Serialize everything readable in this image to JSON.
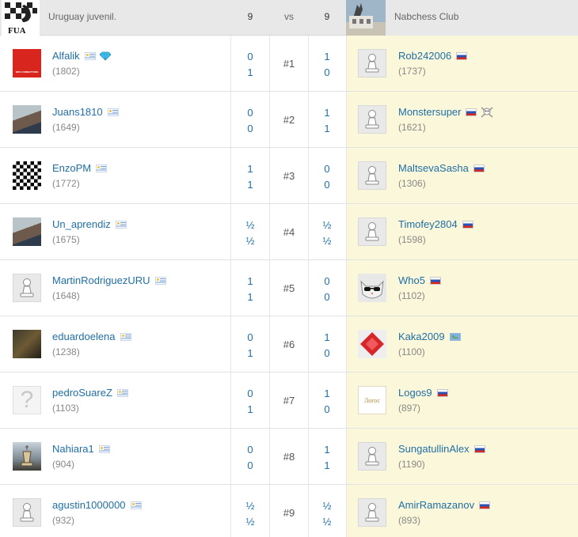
{
  "header": {
    "left_team": "Uruguay juvenil.",
    "left_score": "9",
    "vs": "vs",
    "right_score": "9",
    "right_team": "Nabchess Club",
    "left_logo_text": "FUA"
  },
  "colors": {
    "link": "#1f6fa5",
    "right_column_bg": "#fbf7db",
    "header_bg": "#e8e8e8"
  },
  "rows": [
    {
      "board": "#1",
      "left": {
        "name": "Alfalik",
        "rating": "(1802)",
        "flag": "uy",
        "badge": "diamond-icon",
        "avatar": "red-photo",
        "avatar_text": "NOS COMBATTONS"
      },
      "left_scores": [
        "0",
        "1"
      ],
      "right_scores": [
        "1",
        "0"
      ],
      "right": {
        "name": "Rob242006",
        "rating": "(1737)",
        "flag": "ru",
        "avatar": "pawn"
      }
    },
    {
      "board": "#2",
      "left": {
        "name": "Juans1810",
        "rating": "(1649)",
        "flag": "uy",
        "avatar": "photo-person"
      },
      "left_scores": [
        "0",
        "0"
      ],
      "right_scores": [
        "1",
        "1"
      ],
      "right": {
        "name": "Monstersuper",
        "rating": "(1621)",
        "flag": "ru",
        "badge": "skull-icon",
        "avatar": "pawn"
      }
    },
    {
      "board": "#3",
      "left": {
        "name": "EnzoPM",
        "rating": "(1772)",
        "flag": "uy",
        "avatar": "checkerboard"
      },
      "left_scores": [
        "1",
        "1"
      ],
      "right_scores": [
        "0",
        "0"
      ],
      "right": {
        "name": "MaltsevaSasha",
        "rating": "(1306)",
        "flag": "ru",
        "avatar": "pawn"
      }
    },
    {
      "board": "#4",
      "left": {
        "name": "Un_aprendiz",
        "rating": "(1675)",
        "flag": "uy",
        "avatar": "photo-person"
      },
      "left_scores": [
        "½",
        "½"
      ],
      "right_scores": [
        "½",
        "½"
      ],
      "right": {
        "name": "Timofey2804",
        "rating": "(1598)",
        "flag": "ru",
        "avatar": "pawn"
      }
    },
    {
      "board": "#5",
      "left": {
        "name": "MartinRodriguezURU",
        "rating": "(1648)",
        "flag": "uy",
        "avatar": "pawn"
      },
      "left_scores": [
        "1",
        "1"
      ],
      "right_scores": [
        "0",
        "0"
      ],
      "right": {
        "name": "Who5",
        "rating": "(1102)",
        "flag": "ru",
        "avatar": "cat-photo"
      }
    },
    {
      "board": "#6",
      "left": {
        "name": "eduardoelena",
        "rating": "(1238)",
        "flag": "uy",
        "avatar": "photo-dark"
      },
      "left_scores": [
        "0",
        "1"
      ],
      "right_scores": [
        "1",
        "0"
      ],
      "right": {
        "name": "Kaka2009",
        "rating": "(1100)",
        "flag": "world",
        "avatar": "red-diamond"
      }
    },
    {
      "board": "#7",
      "left": {
        "name": "pedroSuareZ",
        "rating": "(1103)",
        "flag": "uy",
        "avatar": "question"
      },
      "left_scores": [
        "0",
        "1"
      ],
      "right_scores": [
        "1",
        "0"
      ],
      "right": {
        "name": "Logos9",
        "rating": "(897)",
        "flag": "ru",
        "avatar": "logos",
        "avatar_text": "Логос"
      }
    },
    {
      "board": "#8",
      "left": {
        "name": "Nahiara1",
        "rating": "(904)",
        "flag": "uy",
        "avatar": "chess-photo"
      },
      "left_scores": [
        "0",
        "0"
      ],
      "right_scores": [
        "1",
        "1"
      ],
      "right": {
        "name": "SungatullinAlex",
        "rating": "(1190)",
        "flag": "ru",
        "avatar": "pawn"
      }
    },
    {
      "board": "#9",
      "left": {
        "name": "agustin1000000",
        "rating": "(932)",
        "flag": "uy",
        "avatar": "pawn"
      },
      "left_scores": [
        "½",
        "½"
      ],
      "right_scores": [
        "½",
        "½"
      ],
      "right": {
        "name": "AmirRamazanov",
        "rating": "(893)",
        "flag": "ru",
        "avatar": "pawn"
      }
    }
  ]
}
